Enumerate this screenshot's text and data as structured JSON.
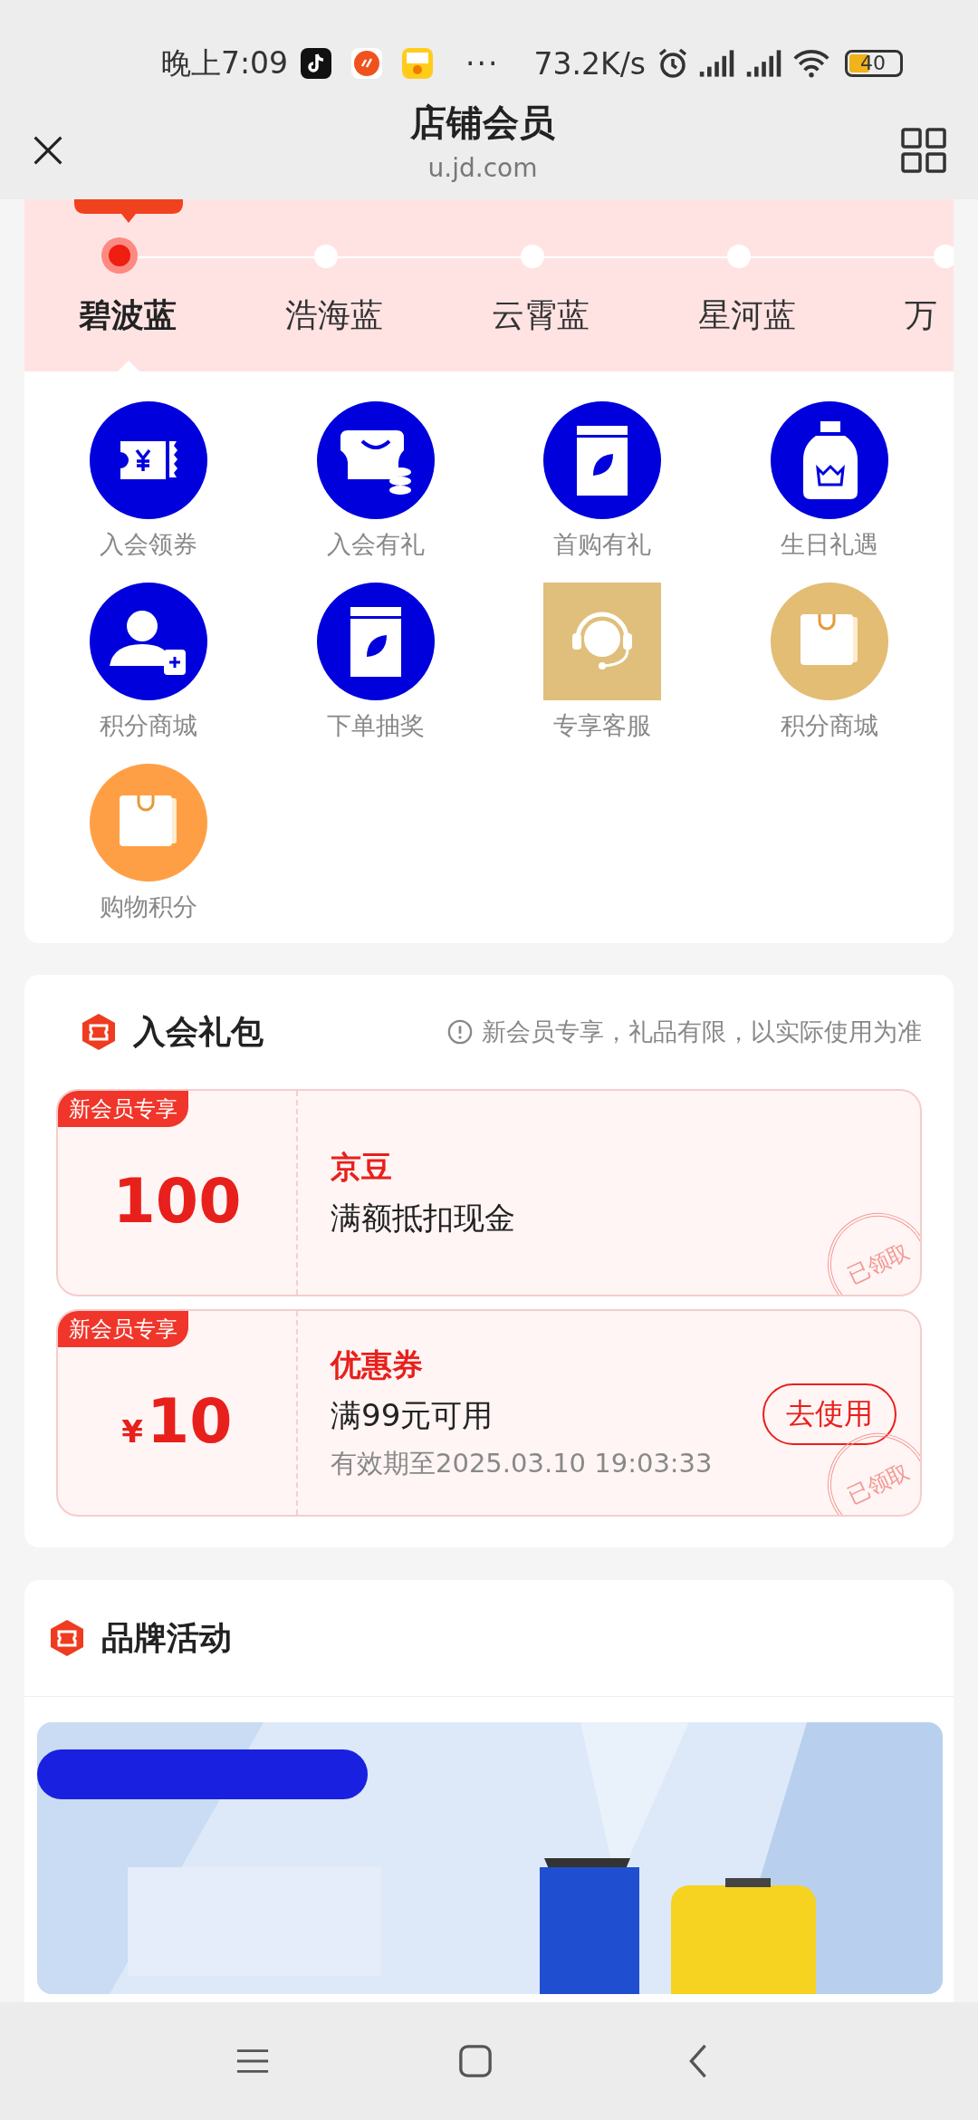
{
  "status_bar": {
    "time": "晚上7:09",
    "more": "···",
    "speed": "73.2K/s",
    "battery": "40"
  },
  "header": {
    "title": "店铺会员",
    "url": "u.jd.com"
  },
  "tiers": [
    {
      "name": "碧波蓝",
      "selected": true
    },
    {
      "name": "浩海蓝",
      "selected": false
    },
    {
      "name": "云霄蓝",
      "selected": false
    },
    {
      "name": "星河蓝",
      "selected": false
    },
    {
      "name": "万",
      "selected": false
    }
  ],
  "benefits": [
    {
      "label": "入会领券",
      "kind": "coupon"
    },
    {
      "label": "入会有礼",
      "kind": "store"
    },
    {
      "label": "首购有礼",
      "kind": "jar"
    },
    {
      "label": "生日礼遇",
      "kind": "bottle"
    },
    {
      "label": "积分商城",
      "kind": "member"
    },
    {
      "label": "下单抽奖",
      "kind": "jar"
    },
    {
      "label": "专享客服",
      "kind": "service"
    },
    {
      "label": "积分商城",
      "kind": "bag-gold"
    },
    {
      "label": "购物积分",
      "kind": "bag-orange"
    }
  ],
  "gift_pack": {
    "title": "入会礼包",
    "note": "新会员专享，礼品有限，以实际使用为准",
    "coupons": [
      {
        "tag": "新会员专享",
        "amount": "100",
        "title": "京豆",
        "description": "满额抵扣现金",
        "stamp": "已领取"
      },
      {
        "tag": "新会员专享",
        "currency": "¥",
        "amount": "10",
        "title": "优惠券",
        "description": "满99元可用",
        "validity": "有效期至2025.03.10 19:03:33",
        "button": "去使用",
        "stamp": "已领取"
      }
    ]
  },
  "brand": {
    "title": "品牌活动"
  }
}
